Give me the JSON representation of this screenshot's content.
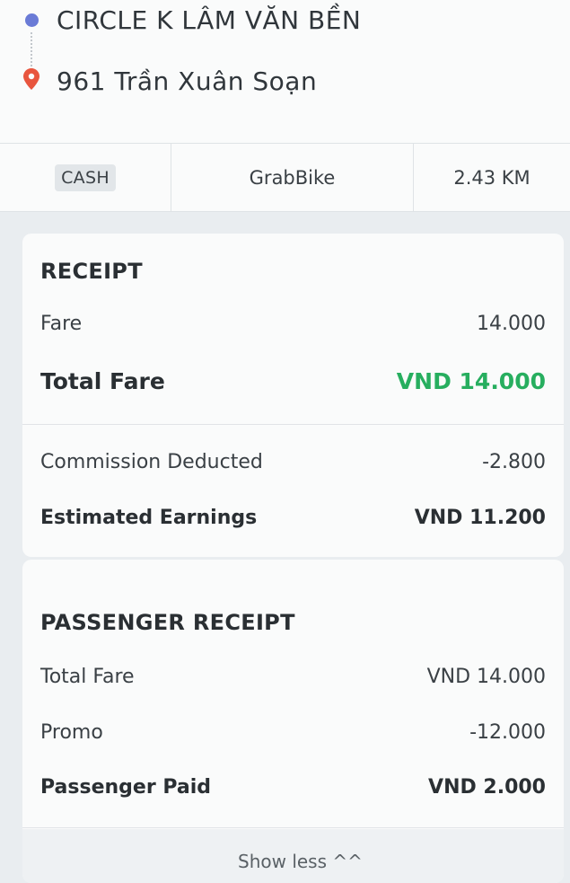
{
  "route": {
    "pickup": "CIRCLE K LÂM VĂN BỀN",
    "dropoff": "961 Trần Xuân Soạn"
  },
  "trip": {
    "payment": "CASH",
    "service": "GrabBike",
    "distance": "2.43 KM"
  },
  "receipt": {
    "title": "RECEIPT",
    "fare_label": "Fare",
    "fare_value": "14.000",
    "total_label": "Total Fare",
    "total_value": "VND 14.000",
    "commission_label": "Commission Deducted",
    "commission_value": "-2.800",
    "earnings_label": "Estimated Earnings",
    "earnings_value": "VND 11.200"
  },
  "passenger_receipt": {
    "title": "PASSENGER RECEIPT",
    "total_label": "Total Fare",
    "total_value": "VND 14.000",
    "promo_label": "Promo",
    "promo_value": "-12.000",
    "paid_label": "Passenger Paid",
    "paid_value": "VND 2.000",
    "show_more": "Show less ^^"
  },
  "colors": {
    "accent_green": "#27ae5f",
    "pickup_dot": "#6a7bd6",
    "dropoff_pin": "#e8553e"
  }
}
